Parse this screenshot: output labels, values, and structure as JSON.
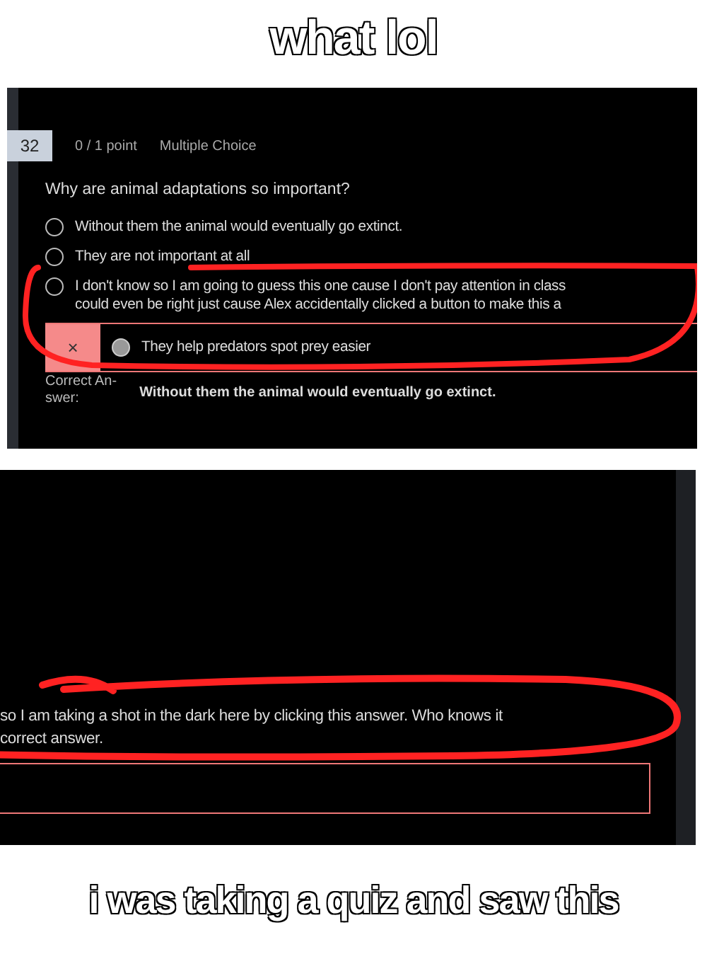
{
  "top_caption": "what lol",
  "quiz_panel": {
    "question_number": "32",
    "score": "0 / 1 point",
    "question_type": "Multiple Choice",
    "question": "Why are animal adaptations so important?",
    "options": [
      {
        "lines": [
          "Without them the animal would eventually go extinct."
        ],
        "selected": false
      },
      {
        "lines": [
          "They are not important at all"
        ],
        "selected": false
      },
      {
        "lines": [
          "I don't know so I am going to guess this one cause I don't pay attention in class",
          "could even be right just cause Alex accidentally clicked a button to make this a"
        ],
        "selected": false
      }
    ],
    "submitted_answer": {
      "mark": "×",
      "text": "They help predators spot prey easier",
      "selected": true,
      "correct": false
    },
    "correct_answer_label": [
      "Correct An-",
      "swer:"
    ],
    "correct_answer": "Without them the animal would eventually go extinct."
  },
  "answer_panel": {
    "answer_lines": [
      "so I am taking a shot in the dark here by clicking this answer. Who knows it",
      "correct answer."
    ],
    "answer_correct": false
  },
  "bottom_caption": "i was taking a quiz and saw this"
}
